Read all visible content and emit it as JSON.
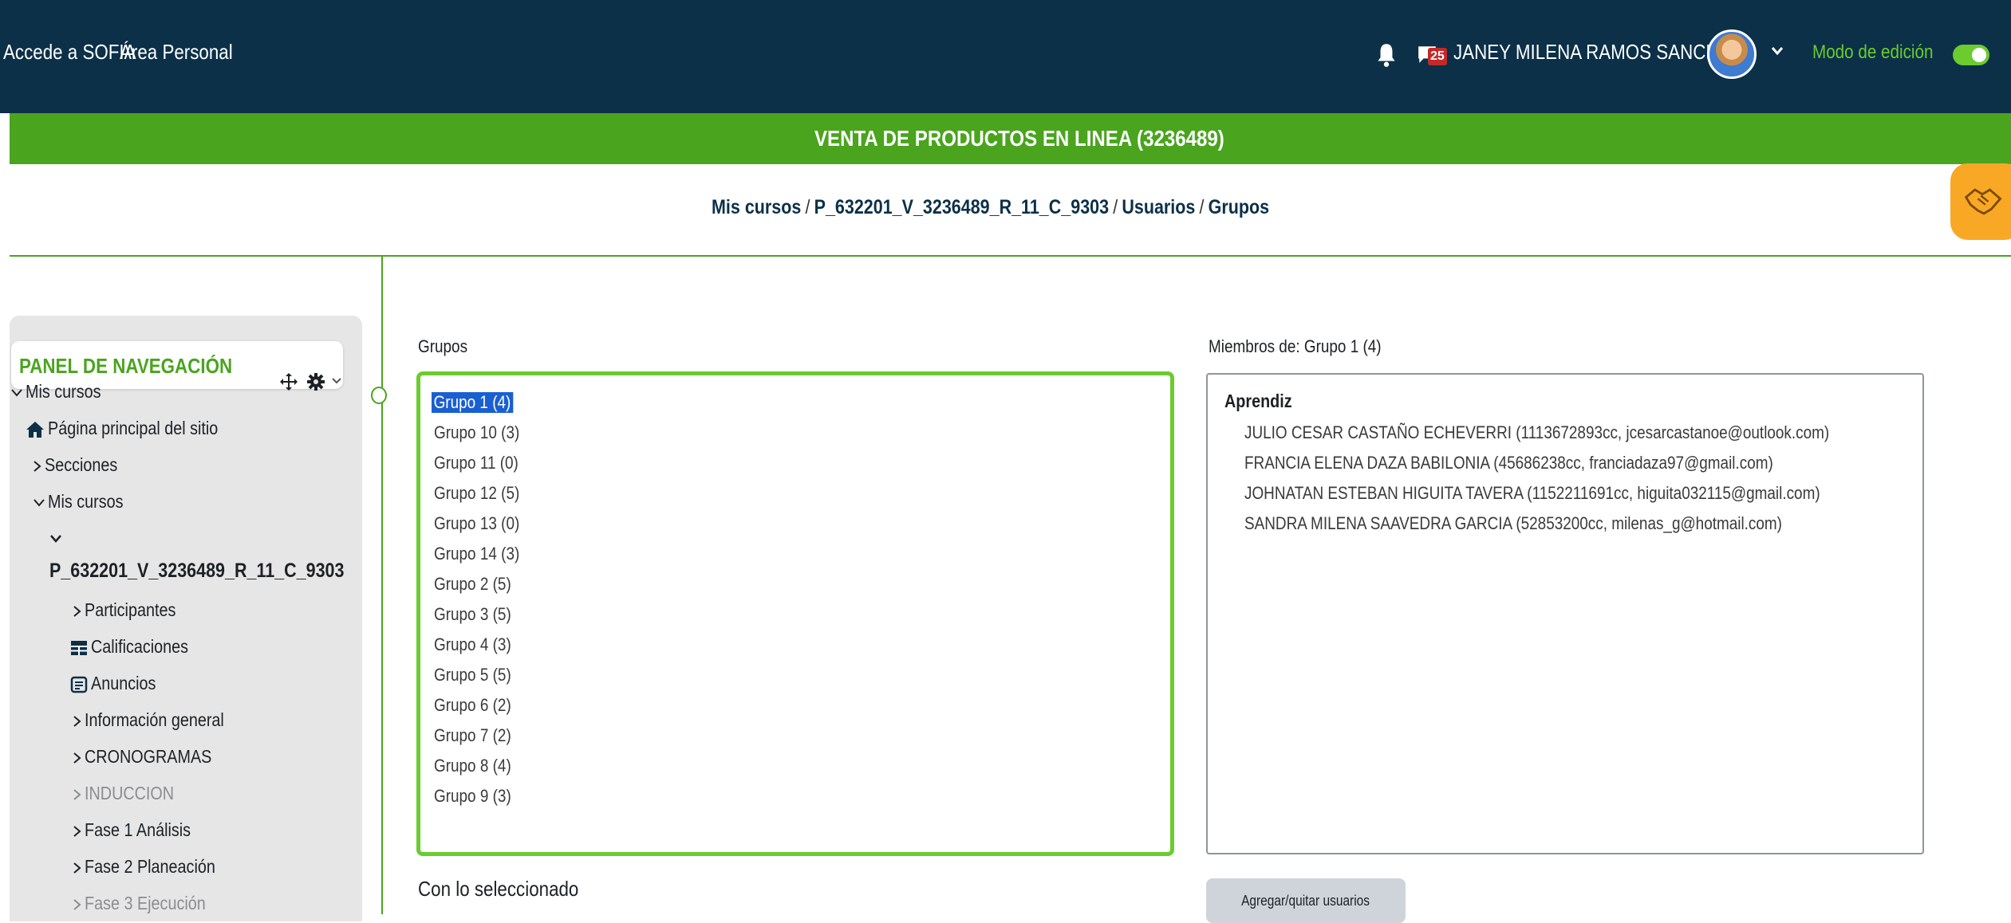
{
  "topbar": {
    "nav_sofia": "Accede a SOFIA",
    "nav_area": "Área Personal",
    "message_badge": "25",
    "user_name": "JANEY MILENA RAMOS SANCHEZ",
    "edit_mode": "Modo de edición",
    "edit_mode_on": true
  },
  "course_bar": {
    "title": "VENTA DE PRODUCTOS EN LINEA (3236489)"
  },
  "breadcrumb": [
    "Mis cursos",
    "P_632201_V_3236489_R_11_C_9303",
    "Usuarios",
    "Grupos"
  ],
  "drawer": {
    "title": "PANEL DE NAVEGACIÓN",
    "items": [
      {
        "label": "Mis cursos"
      },
      {
        "label": "Página principal del sitio"
      },
      {
        "label": "Secciones"
      },
      {
        "label": "Mis cursos"
      },
      {
        "label": "P_632201_V_3236489_R_11_C_9303"
      },
      {
        "label": "Participantes"
      },
      {
        "label": "Calificaciones"
      },
      {
        "label": "Anuncios"
      },
      {
        "label": "Información general"
      },
      {
        "label": "CRONOGRAMAS"
      },
      {
        "label": "INDUCCION"
      },
      {
        "label": "Fase 1 Análisis"
      },
      {
        "label": "Fase 2 Planeación"
      },
      {
        "label": "Fase 3 Ejecución"
      }
    ]
  },
  "groups": {
    "label": "Grupos",
    "selected_index": 0,
    "options": [
      "Grupo 1 (4)",
      "Grupo 10 (3)",
      "Grupo 11 (0)",
      "Grupo 12 (5)",
      "Grupo 13 (0)",
      "Grupo 14 (3)",
      "Grupo 2 (5)",
      "Grupo 3 (5)",
      "Grupo 4 (3)",
      "Grupo 5 (5)",
      "Grupo 6 (2)",
      "Grupo 7 (2)",
      "Grupo 8 (4)",
      "Grupo 9 (3)"
    ]
  },
  "members": {
    "label": "Miembros de: Grupo 1 (4)",
    "role": "Aprendiz",
    "list": [
      "JULIO CESAR CASTAÑO ECHEVERRI (1113672893cc, jcesarcastanoe@outlook.com)",
      "FRANCIA ELENA DAZA BABILONIA (45686238cc, franciadaza97@gmail.com)",
      "JOHNATAN ESTEBAN HIGUITA TAVERA (1152211691cc, higuita032115@gmail.com)",
      "SANDRA MILENA SAAVEDRA GARCIA (52853200cc, milenas_g@hotmail.com)"
    ]
  },
  "footer": {
    "with_selected": "Con lo seleccionado",
    "add_remove_button": "Agregar/quitar usuarios"
  },
  "colors": {
    "navbar": "#0b3048",
    "accent_green": "#4aa41e",
    "toggle_green": "#6bcb2f",
    "selection_blue": "#1a5fd1"
  }
}
